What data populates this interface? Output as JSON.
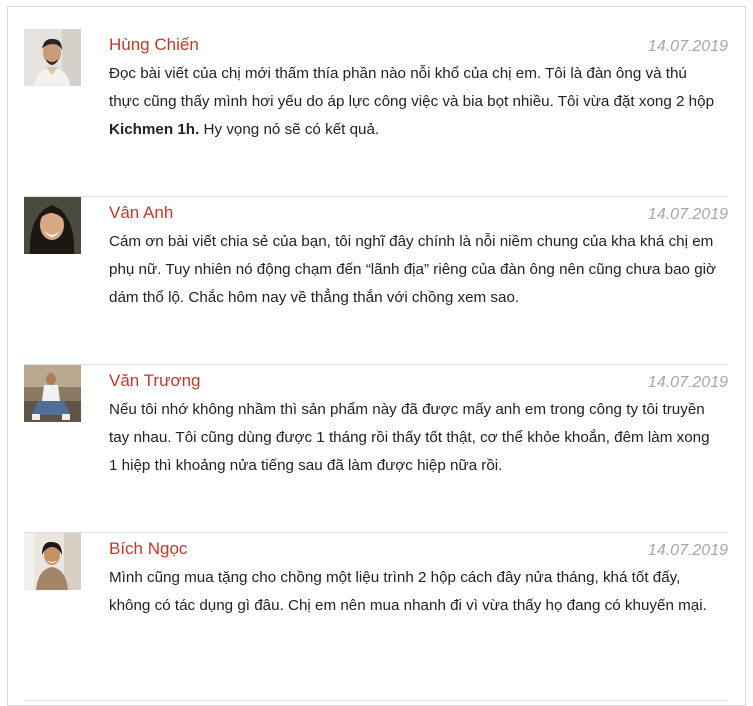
{
  "comments": [
    {
      "name": "Hùng Chiến",
      "date": "14.07.2019",
      "text_before": "Đọc bài viết của chị mới thấm thía phần nào nỗi khổ của chị em. Tôi là đàn ông và thú thực cũng thấy mình hơi yếu do áp lực công việc và bia bọt nhiều. Tôi vừa đặt xong 2 hộp ",
      "text_bold": "Kichmen 1h.",
      "text_after": " Hy vọng nó sẽ có kết quả."
    },
    {
      "name": "Vân Anh",
      "date": "14.07.2019",
      "text": "Cám ơn bài viết chia sẻ của bạn, tôi nghĩ đây chính là nỗi niềm chung của kha khá chị em phụ nữ. Tuy nhiên nó động chạm đến “lãnh địa” riêng của đàn ông nên cũng chưa bao giờ dám thổ lộ. Chắc hôm nay về thẳng thắn với chồng xem sao."
    },
    {
      "name": "Văn Trương",
      "date": "14.07.2019",
      "text": "Nếu tôi nhớ không nhầm thì sản phẩm này đã được mấy anh em trong công ty tôi truyền tay nhau. Tôi cũng dùng được 1 tháng rồi thấy tốt thật, cơ thể khỏe khoắn, đêm làm xong 1 hiệp thì khoảng nửa tiếng sau đã làm được hiệp nữa rồi."
    },
    {
      "name": "Bích Ngọc",
      "date": "14.07.2019",
      "text": "Mình cũng mua tặng cho chồng một liệu trình 2 hộp cách đây nửa tháng, khá tốt đấy, không có tác dụng gì đâu. Chị em nên mua nhanh đi vì vừa thấy họ đang có khuyến mại."
    }
  ]
}
